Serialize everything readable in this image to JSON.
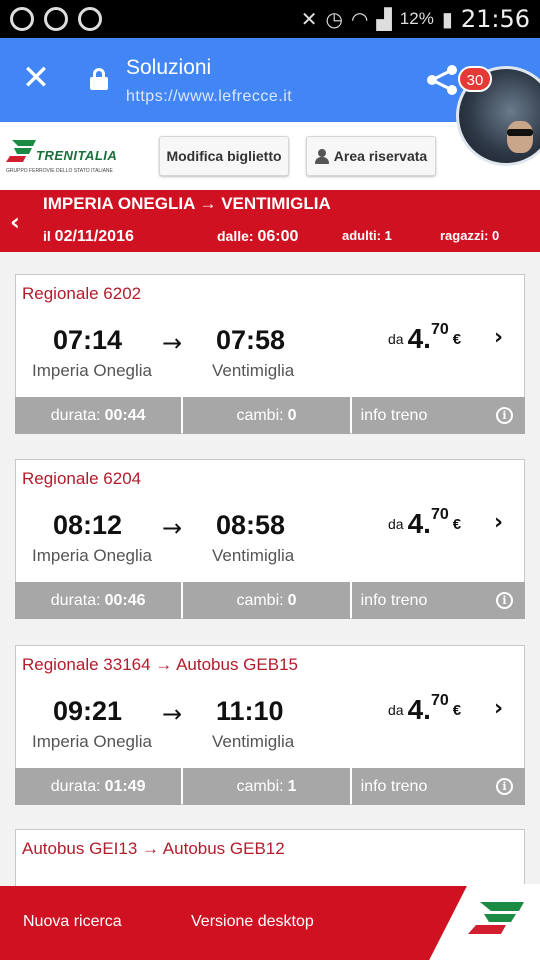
{
  "statusbar": {
    "battery": "12%",
    "time": "21:56",
    "icons": [
      "messenger-icon",
      "whatsapp-icon",
      "chat-icon",
      "mute-icon",
      "alarm-icon",
      "wifi-icon",
      "signal-icon",
      "battery-icon"
    ]
  },
  "toolbar": {
    "title": "Soluzioni",
    "url": "https://www.lefrecce.it",
    "badge_count": "30",
    "icons": [
      "close-icon",
      "lock-icon",
      "share-icon"
    ]
  },
  "header": {
    "logo_text": "TRENITALIA",
    "logo_subtext": "GRUPPO FERROVIE DELLO STATO ITALIANE",
    "modify_button": "Modifica biglietto",
    "area_button": "Area riservata"
  },
  "route": {
    "title": "IMPERIA ONEGLIA → VENTIMIGLIA",
    "date_label": "il",
    "date": "02/11/2016",
    "from_label": "dalle:",
    "from_time": "06:00",
    "adults": "adulti: 1",
    "children": "ragazzi: 0"
  },
  "solutions": [
    {
      "name": "Regionale 6202",
      "departure": "07:14",
      "arrival": "07:58",
      "from": "Imperia Oneglia",
      "to": "Ventimiglia",
      "price_prefix": "da",
      "price_int": "4.",
      "price_dec": "70",
      "currency": "€",
      "duration_label": "durata:",
      "duration": "00:44",
      "changes_label": "cambi:",
      "changes": "0",
      "info_label": "info treno"
    },
    {
      "name": "Regionale 6204",
      "departure": "08:12",
      "arrival": "08:58",
      "from": "Imperia Oneglia",
      "to": "Ventimiglia",
      "price_prefix": "da",
      "price_int": "4.",
      "price_dec": "70",
      "currency": "€",
      "duration_label": "durata:",
      "duration": "00:46",
      "changes_label": "cambi:",
      "changes": "0",
      "info_label": "info treno"
    },
    {
      "name": "Regionale 33164 → Autobus GEB15",
      "departure": "09:21",
      "arrival": "11:10",
      "from": "Imperia Oneglia",
      "to": "Ventimiglia",
      "price_prefix": "da",
      "price_int": "4.",
      "price_dec": "70",
      "currency": "€",
      "duration_label": "durata:",
      "duration": "01:49",
      "changes_label": "cambi:",
      "changes": "1",
      "info_label": "info treno"
    },
    {
      "name": "Autobus GEI13 → Autobus GEB12"
    }
  ],
  "bottombar": {
    "new_search": "Nuova ricerca",
    "desktop_version": "Versione desktop"
  },
  "colors": {
    "toolbar_blue": "#4286f5",
    "trenitalia_red": "#cf1122",
    "footer_gray": "#a7a7a7",
    "title_red": "#b31c2b"
  }
}
